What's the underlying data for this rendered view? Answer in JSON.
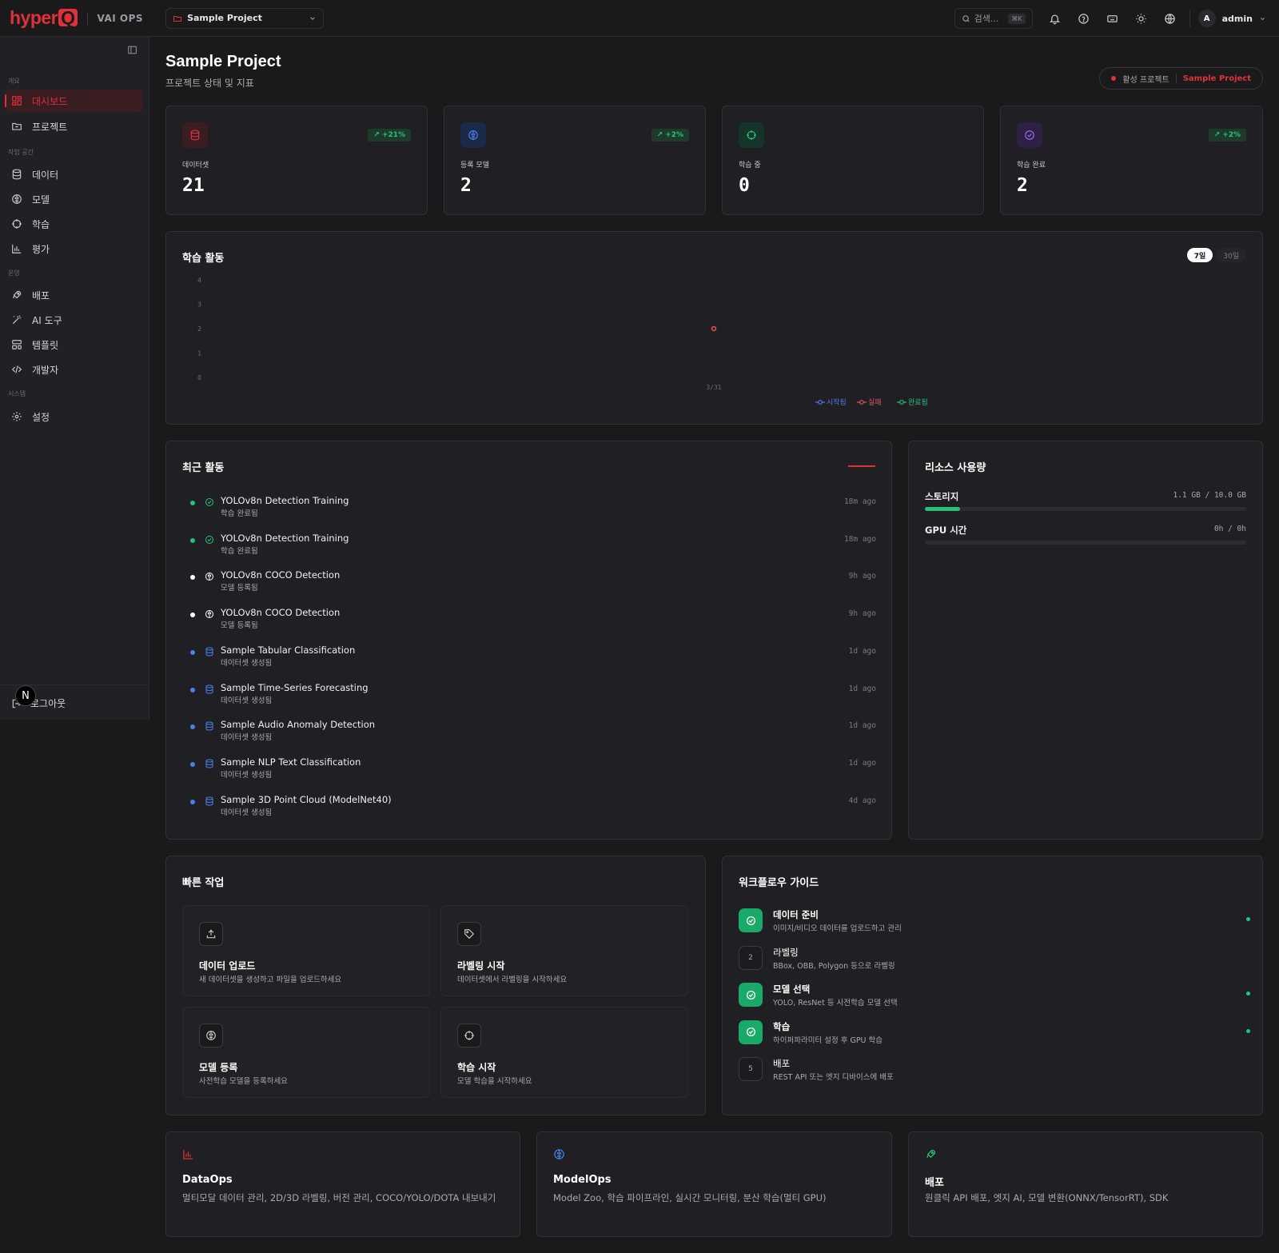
{
  "topbar": {
    "logo": "hyper",
    "logo_mark": "Q",
    "app_name": "VAI OPS",
    "project": "Sample Project",
    "search_placeholder": "검색...",
    "search_shortcut": "⌘K",
    "user_initial": "A",
    "user_name": "admin"
  },
  "sidebar": {
    "groups": {
      "overview": "개요",
      "workspace": "작업 공간",
      "operations": "운영",
      "system": "시스템"
    },
    "items": [
      {
        "label": "대시보드",
        "icon": "dashboard-icon",
        "active": true
      },
      {
        "label": "프로젝트",
        "icon": "folder-icon"
      },
      {
        "label": "데이터",
        "icon": "database-icon"
      },
      {
        "label": "모델",
        "icon": "brain-icon"
      },
      {
        "label": "학습",
        "icon": "target-icon"
      },
      {
        "label": "평가",
        "icon": "bar-chart-icon"
      },
      {
        "label": "배포",
        "icon": "rocket-icon"
      },
      {
        "label": "AI 도구",
        "icon": "wand-icon"
      },
      {
        "label": "템플릿",
        "icon": "template-icon"
      },
      {
        "label": "개발자",
        "icon": "code-icon"
      },
      {
        "label": "설정",
        "icon": "gear-icon"
      }
    ],
    "logout": "로그아웃",
    "n_badge": "N"
  },
  "header": {
    "title": "Sample Project",
    "subtitle": "프로젝트 상태 및 지표",
    "active_label": "활성 프로젝트",
    "active_project": "Sample Project"
  },
  "stats": [
    {
      "label": "데이터셋",
      "value": "21",
      "trend": "+21%",
      "icon": "database-icon",
      "color": "#e0313b"
    },
    {
      "label": "등록 모델",
      "value": "2",
      "trend": "+2%",
      "icon": "brain-icon",
      "color": "#4c7fe8"
    },
    {
      "label": "학습 중",
      "value": "0",
      "trend": "",
      "icon": "target-icon",
      "color": "#27c27a"
    },
    {
      "label": "학습 완료",
      "value": "2",
      "trend": "+2%",
      "icon": "check-circle-icon",
      "color": "#a266e8"
    }
  ],
  "activity_chart": {
    "title": "학습 활동",
    "ranges": [
      "7일",
      "30일"
    ],
    "selected_range": "7일"
  },
  "chart_data": {
    "type": "line",
    "x": [
      "3/31"
    ],
    "series": [
      {
        "name": "시작됨",
        "values": [
          0
        ],
        "color": "#4c7fe8"
      },
      {
        "name": "실패",
        "values": [
          2
        ],
        "color": "#e05560"
      },
      {
        "name": "완료됨",
        "values": [
          0
        ],
        "color": "#27c27a"
      }
    ],
    "ylim": [
      0,
      4
    ],
    "yticks": [
      "0",
      "1",
      "2",
      "3",
      "4"
    ],
    "legend": "bottom",
    "grid": false
  },
  "recent": {
    "title": "최근 활동",
    "items": [
      {
        "title": "YOLOv8n Detection Training",
        "sub": "학습 완료됨",
        "time": "18m ago",
        "kind": "done"
      },
      {
        "title": "YOLOv8n Detection Training",
        "sub": "학습 완료됨",
        "time": "18m ago",
        "kind": "done"
      },
      {
        "title": "YOLOv8n COCO Detection",
        "sub": "모델 등록됨",
        "time": "9h ago",
        "kind": "model"
      },
      {
        "title": "YOLOv8n COCO Detection",
        "sub": "모델 등록됨",
        "time": "9h ago",
        "kind": "model"
      },
      {
        "title": "Sample Tabular Classification",
        "sub": "데이터셋 생성됨",
        "time": "1d ago",
        "kind": "data"
      },
      {
        "title": "Sample Time-Series Forecasting",
        "sub": "데이터셋 생성됨",
        "time": "1d ago",
        "kind": "data"
      },
      {
        "title": "Sample Audio Anomaly Detection",
        "sub": "데이터셋 생성됨",
        "time": "1d ago",
        "kind": "data"
      },
      {
        "title": "Sample NLP Text Classification",
        "sub": "데이터셋 생성됨",
        "time": "1d ago",
        "kind": "data"
      },
      {
        "title": "Sample 3D Point Cloud (ModelNet40)",
        "sub": "데이터셋 생성됨",
        "time": "4d ago",
        "kind": "data"
      }
    ]
  },
  "resources": {
    "title": "리소스 사용량",
    "storage_label": "스토리지",
    "storage_value": "1.1 GB / 10.0 GB",
    "storage_fraction": 0.11,
    "gpu_label": "GPU 시간",
    "gpu_value": "0h / 0h",
    "gpu_fraction": 0
  },
  "quick": {
    "title": "빠른 작업",
    "items": [
      {
        "title": "데이터 업로드",
        "desc": "새 데이터셋을 생성하고 파일을 업로드하세요",
        "icon": "upload-icon"
      },
      {
        "title": "라벨링 시작",
        "desc": "데이터셋에서 라벨링을 시작하세요",
        "icon": "tag-icon"
      },
      {
        "title": "모델 등록",
        "desc": "사전학습 모델을 등록하세요",
        "icon": "brain-icon"
      },
      {
        "title": "학습 시작",
        "desc": "모델 학습을 시작하세요",
        "icon": "target-icon"
      }
    ]
  },
  "workflow": {
    "title": "워크플로우 가이드",
    "steps": [
      {
        "title": "데이터 준비",
        "desc": "이미지/비디오 데이터를 업로드하고 관리",
        "done": true,
        "num": "1"
      },
      {
        "title": "라벨링",
        "desc": "BBox, OBB, Polygon 등으로 라벨링",
        "done": false,
        "num": "2"
      },
      {
        "title": "모델 선택",
        "desc": "YOLO, ResNet 등 사전학습 모델 선택",
        "done": true,
        "num": "3"
      },
      {
        "title": "학습",
        "desc": "하이퍼파라미터 설정 후 GPU 학습",
        "done": true,
        "num": "4"
      },
      {
        "title": "배포",
        "desc": "REST API 또는 엣지 디바이스에 배포",
        "done": false,
        "num": "5"
      }
    ]
  },
  "features": [
    {
      "title": "DataOps",
      "desc": "멀티모달 데이터 관리, 2D/3D 라벨링, 버전 관리, COCO/YOLO/DOTA 내보내기",
      "icon": "bar-chart-icon",
      "color": "#e0313b"
    },
    {
      "title": "ModelOps",
      "desc": "Model Zoo, 학습 파이프라인, 실시간 모니터링, 분산 학습(멀티 GPU)",
      "icon": "brain-icon",
      "color": "#4c7fe8"
    },
    {
      "title": "배포",
      "desc": "원클릭 API 배포, 엣지 AI, 모델 변환(ONNX/TensorRT), SDK",
      "icon": "rocket-icon",
      "color": "#27c27a"
    }
  ]
}
